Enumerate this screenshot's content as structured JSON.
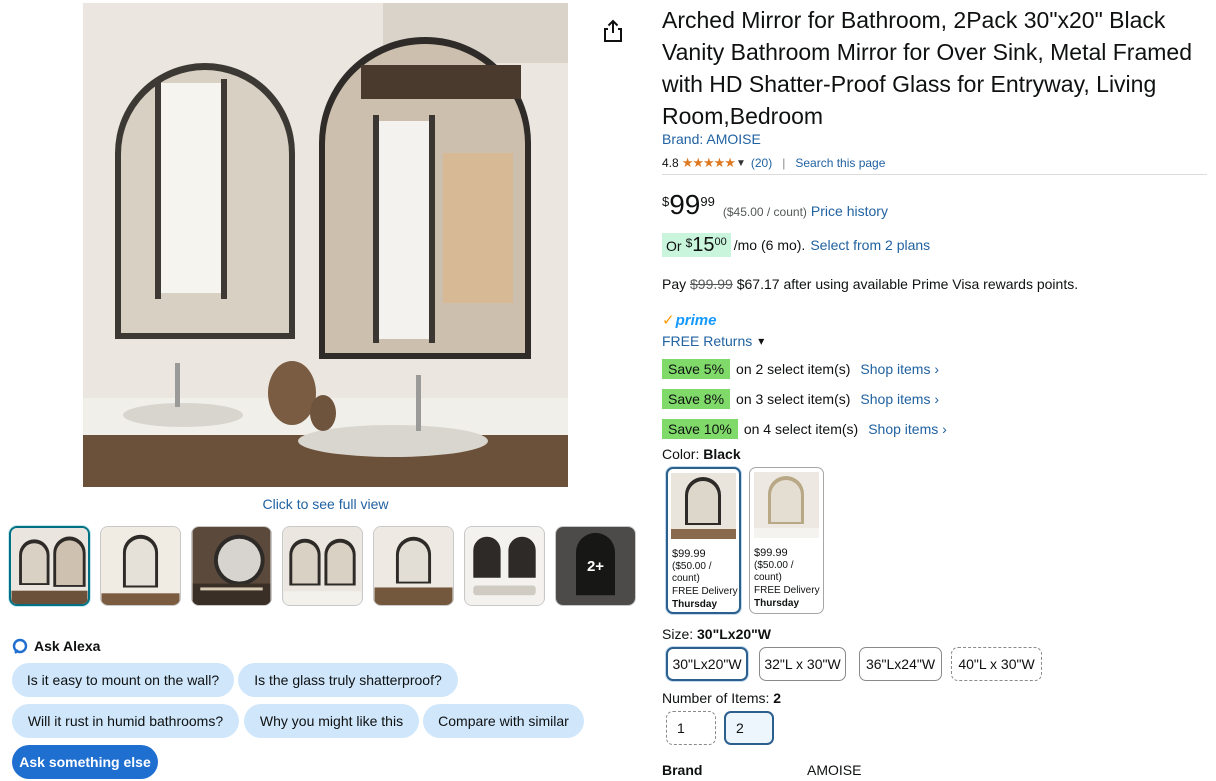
{
  "gallery": {
    "full_view": "Click to see full view",
    "more_label": "2+"
  },
  "alexa": {
    "title": "Ask Alexa",
    "chips": [
      "Is it easy to mount on the wall?",
      "Is the glass truly shatterproof?",
      "Will it rust in humid bathrooms?",
      "Why you might like this",
      "Compare with similar"
    ],
    "ask_more": "Ask something else"
  },
  "product": {
    "title": "Arched Mirror for Bathroom, 2Pack 30\"x20\" Black Vanity Bathroom Mirror for Over Sink, Metal Framed with HD Shatter-Proof Glass for Entryway, Living Room,Bedroom",
    "brand_link": "Brand: AMOISE",
    "rating": "4.8",
    "stars": "★★★★★",
    "rating_value": 4.8,
    "rating_count": "(20)",
    "search_page": "Search this page",
    "price": {
      "symbol": "$",
      "whole": "99",
      "fraction": "99",
      "unit_price": "($45.00 / count)",
      "history": "Price history"
    },
    "monthly": {
      "or": "Or",
      "symbol": "$",
      "whole": "15",
      "fraction": "00",
      "per": "/mo (6 mo).",
      "plans": "Select from 2 plans"
    },
    "pay_note": {
      "prefix": "Pay",
      "old_price": "$99.99",
      "rest": "$67.17 after using available Prime Visa rewards points."
    },
    "prime": "prime",
    "returns": "FREE Returns",
    "savings": [
      {
        "badge": "Save 5%",
        "text": "on 2 select item(s)",
        "link": "Shop items ›"
      },
      {
        "badge": "Save 8%",
        "text": "on 3 select item(s)",
        "link": "Shop items ›"
      },
      {
        "badge": "Save 10%",
        "text": "on 4 select item(s)",
        "link": "Shop items ›"
      }
    ],
    "color": {
      "label": "Color:",
      "selected": "Black",
      "options": [
        {
          "price": "$99.99",
          "unit": "($50.00 / count)",
          "delivery": "FREE Delivery",
          "day": "Thursday"
        },
        {
          "price": "$99.99",
          "unit": "($50.00 / count)",
          "delivery": "FREE Delivery",
          "day": "Thursday"
        }
      ]
    },
    "size": {
      "label": "Size:",
      "selected": "30\"Lx20\"W",
      "options": [
        "30\"Lx20\"W",
        "32\"L x 30\"W",
        "36\"Lx24\"W",
        "40\"L x 30\"W"
      ]
    },
    "items": {
      "label": "Number of Items:",
      "selected": "2",
      "options": [
        "1",
        "2"
      ]
    },
    "spec": {
      "key": "Brand",
      "value": "AMOISE"
    }
  },
  "colors": {
    "link": "#2162a1",
    "save_badge": "#7fda69",
    "monthly_badge": "#c9f5dc",
    "star": "#de7921",
    "alexa_chip": "#cfe6fb",
    "selected_border": "#2b5f8e"
  }
}
